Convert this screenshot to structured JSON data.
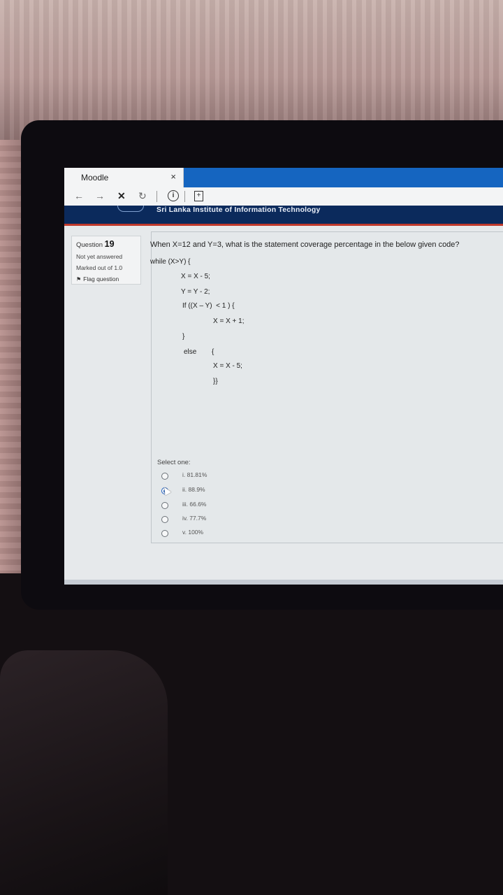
{
  "browser": {
    "tab_title": "Moodle",
    "tab_close": "×",
    "nav_back": "←",
    "nav_forward": "→",
    "nav_stop": "✕",
    "nav_reload": "↻",
    "info_glyph": "i",
    "newtab_glyph": "+"
  },
  "site": {
    "name": "Sri Lanka Institute of Information Technology"
  },
  "question_info": {
    "label": "Question",
    "number": "19",
    "state": "Not yet answered",
    "grade": "Marked out of 1.0",
    "flag_label": "Flag question"
  },
  "question": {
    "text": "When X=12 and Y=3, what is the statement coverage percentage in the below given code?",
    "code": [
      "while (X>Y) {",
      "X = X - 5;",
      "Y = Y - 2;",
      "If ((X – Y)  < 1 ) {",
      "X = X + 1;",
      "}",
      "else",
      "{",
      "X = X - 5;",
      "}}"
    ],
    "select_label": "Select one:",
    "options": [
      {
        "label": "i. 81.81%",
        "selected": false
      },
      {
        "label": "ii. 88.9%",
        "selected": true
      },
      {
        "label": "iii. 66.6%",
        "selected": false
      },
      {
        "label": "iv. 77.7%",
        "selected": false
      },
      {
        "label": "v. 100%",
        "selected": false
      }
    ]
  },
  "colors": {
    "tab_accent": "#1565c0",
    "header_bg": "#0b2a5c",
    "header_rule": "#c0392b",
    "radio_selected": "#1f5fbf"
  }
}
